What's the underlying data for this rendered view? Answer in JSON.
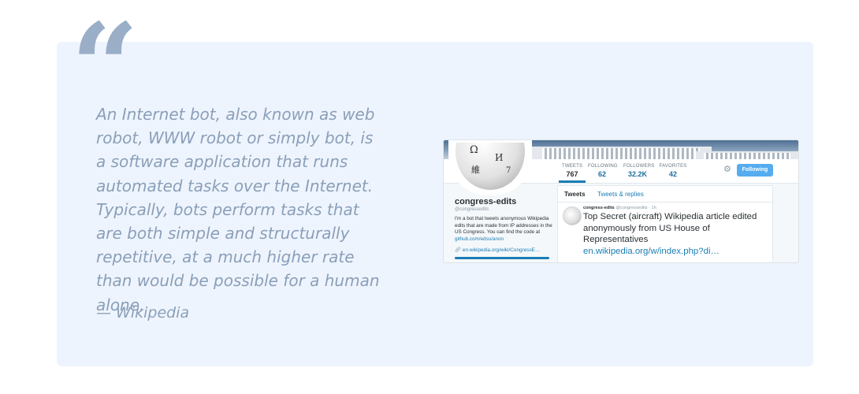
{
  "quote": {
    "mark": "“",
    "text": "An Internet bot, also known as web robot, WWW robot or simply bot, is a software application that runs automated tasks over the Internet. Typically, bots perform tasks that are both simple and structurally repetitive, at a much higher rate than would be possible for a human alone.",
    "attribution": "— Wikipedia"
  },
  "profile_card": {
    "stats": [
      {
        "label": "TWEETS",
        "value": "767"
      },
      {
        "label": "FOLLOWING",
        "value": "62"
      },
      {
        "label": "FOLLOWERS",
        "value": "32.2K"
      },
      {
        "label": "FAVORITES",
        "value": "42"
      }
    ],
    "follow_button": "Following",
    "name": "congress-edits",
    "handle": "@congressedits",
    "bio": "I'm a bot that tweets anonymous Wikipedia edits that are made from IP addresses in the US Congress. You can find the code at",
    "bio_link": "github.com/edsu/anon",
    "url": "en.wikipedia.org/wiki/CongressE…",
    "tabs": {
      "tweets": "Tweets",
      "replies": "Tweets & replies"
    },
    "tweet": {
      "name": "congress-edits",
      "meta": "@congressedits · 1h",
      "text": "Top Secret (aircraft) Wikipedia article edited anonymously from US House of Representatives",
      "link": "en.wikipedia.org/w/index.php?di…"
    }
  },
  "colors": {
    "card_background": "#eef4fd",
    "quote_text": "#8a9fb9",
    "twitter_blue": "#55acee",
    "link_blue": "#1b7db4"
  },
  "icons": {
    "quote": "quote-mark-icon",
    "settings": "gear-icon",
    "link": "chain-link-icon",
    "avatar": "wikipedia-globe-icon"
  }
}
